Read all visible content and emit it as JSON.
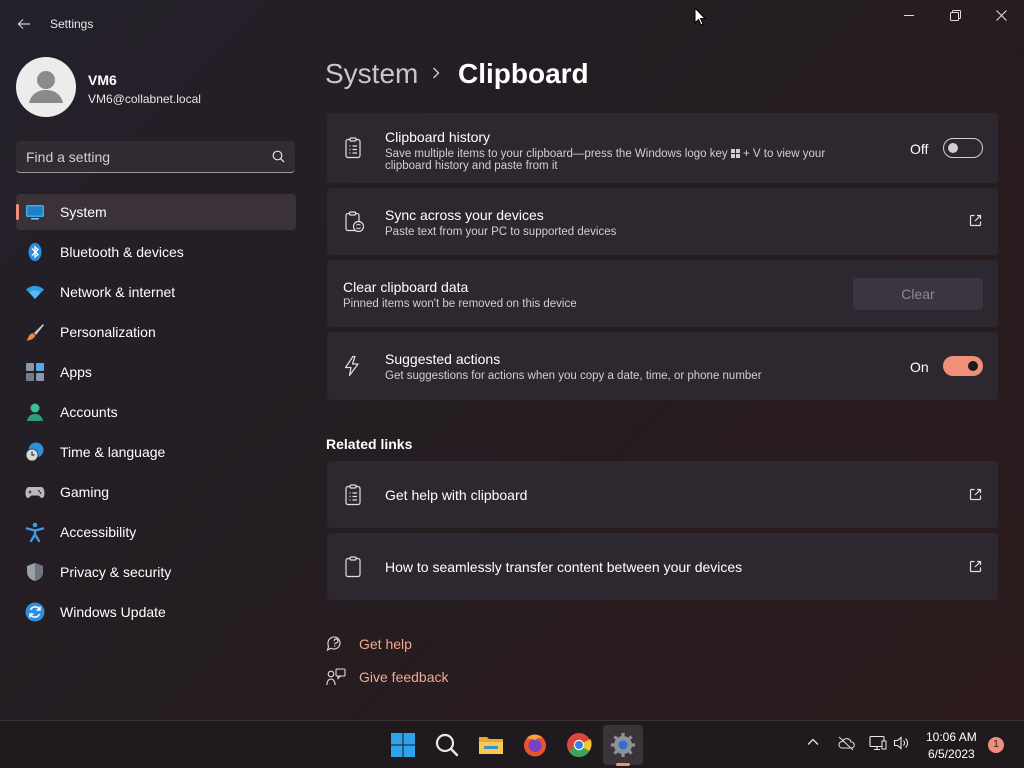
{
  "window": {
    "title": "Settings"
  },
  "user": {
    "name": "VM6",
    "email": "VM6@collabnet.local"
  },
  "search": {
    "placeholder": "Find a setting"
  },
  "sidebar": {
    "items": [
      {
        "label": "System",
        "icon": "system-icon",
        "active": true
      },
      {
        "label": "Bluetooth & devices",
        "icon": "bluetooth-icon"
      },
      {
        "label": "Network & internet",
        "icon": "wifi-icon"
      },
      {
        "label": "Personalization",
        "icon": "brush-icon"
      },
      {
        "label": "Apps",
        "icon": "apps-icon"
      },
      {
        "label": "Accounts",
        "icon": "accounts-icon"
      },
      {
        "label": "Time & language",
        "icon": "clock-globe-icon"
      },
      {
        "label": "Gaming",
        "icon": "gamepad-icon"
      },
      {
        "label": "Accessibility",
        "icon": "accessibility-icon"
      },
      {
        "label": "Privacy & security",
        "icon": "shield-icon"
      },
      {
        "label": "Windows Update",
        "icon": "update-icon"
      }
    ]
  },
  "breadcrumb": {
    "parent": "System",
    "separator": "›",
    "current": "Clipboard"
  },
  "settings": {
    "clipboard_history": {
      "title": "Clipboard history",
      "desc_line1": "Save multiple items to your clipboard—press the Windows logo key",
      "desc_key_suffix": "+ V to view your",
      "desc_line2": "clipboard history and paste from it",
      "state_label": "Off",
      "state": false
    },
    "sync": {
      "title": "Sync across your devices",
      "desc": "Paste text from your PC to supported devices"
    },
    "clear": {
      "title": "Clear clipboard data",
      "desc": "Pinned items won't be removed on this device",
      "button": "Clear"
    },
    "suggested": {
      "title": "Suggested actions",
      "desc": "Get suggestions for actions when you copy a date, time, or phone number",
      "state_label": "On",
      "state": true
    }
  },
  "related": {
    "heading": "Related links",
    "links": [
      {
        "label": "Get help with clipboard"
      },
      {
        "label": "How to seamlessly transfer content between your devices"
      }
    ]
  },
  "footer": {
    "get_help": "Get help",
    "give_feedback": "Give feedback"
  },
  "taskbar": {
    "time": "10:06 AM",
    "date": "6/5/2023",
    "notification_count": "1"
  },
  "colors": {
    "accent": "#f0907a",
    "card": "#2d282f",
    "link": "#f0a890"
  }
}
